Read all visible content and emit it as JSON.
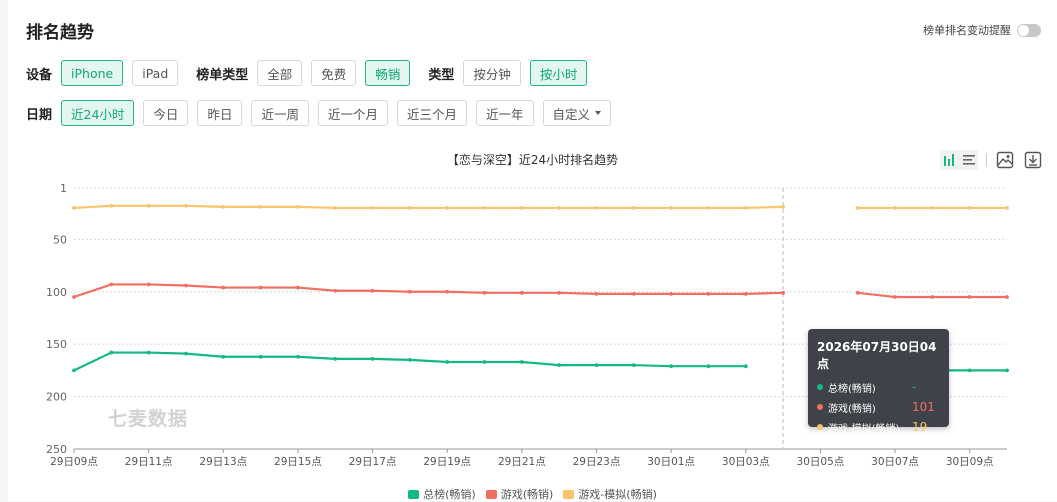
{
  "title": "排名趋势",
  "alert_toggle_label": "榜单排名变动提醒",
  "filters": {
    "device_label": "设备",
    "devices": [
      {
        "label": "iPhone",
        "active": true
      },
      {
        "label": "iPad",
        "active": false
      }
    ],
    "list_type_label": "榜单类型",
    "list_types": [
      {
        "label": "全部",
        "active": false
      },
      {
        "label": "免费",
        "active": false
      },
      {
        "label": "畅销",
        "active": true
      }
    ],
    "type_label": "类型",
    "types": [
      {
        "label": "按分钟",
        "active": false
      },
      {
        "label": "按小时",
        "active": true
      }
    ],
    "date_label": "日期",
    "dates": [
      {
        "label": "近24小时",
        "active": true
      },
      {
        "label": "今日",
        "active": false
      },
      {
        "label": "昨日",
        "active": false
      },
      {
        "label": "近一周",
        "active": false
      },
      {
        "label": "近一个月",
        "active": false
      },
      {
        "label": "近三个月",
        "active": false
      },
      {
        "label": "近一年",
        "active": false
      }
    ],
    "custom_label": "自定义"
  },
  "watermark": "七麦数据",
  "colors": {
    "accent": "#11a777",
    "series1": "#12b886",
    "series2": "#f16e63",
    "series3": "#f9c46b"
  },
  "tooltip": {
    "title": "2026年07月30日04点",
    "rows": [
      {
        "name": "总榜(畅销)",
        "value": "-",
        "color": "#12b886"
      },
      {
        "name": "游戏(畅销)",
        "value": "101",
        "color": "#f16e63"
      },
      {
        "name": "游戏-模拟(畅销)",
        "value": "19",
        "color": "#f9c46b"
      }
    ]
  },
  "chart_data": {
    "type": "line",
    "title": "【恋与深空】近24小时排名趋势",
    "x_tick_labels": [
      "29日09点",
      "29日11点",
      "29日13点",
      "29日15点",
      "29日17点",
      "29日19点",
      "29日21点",
      "29日23点",
      "30日01点",
      "30日03点",
      "30日05点",
      "30日07点",
      "30日09点"
    ],
    "y_ticks": [
      1,
      50,
      100,
      150,
      200,
      250
    ],
    "ylim": [
      1,
      250
    ],
    "y_inverted": true,
    "grid": true,
    "legend_position": "bottom",
    "hover_index": 19,
    "series": [
      {
        "name": "总榜(畅销)",
        "color": "#12b886",
        "values": [
          175,
          158,
          158,
          159,
          162,
          162,
          162,
          164,
          164,
          165,
          167,
          167,
          167,
          170,
          170,
          170,
          171,
          171,
          171,
          null,
          null,
          null,
          175,
          175,
          175,
          175
        ]
      },
      {
        "name": "游戏(畅销)",
        "color": "#f16e63",
        "values": [
          105,
          93,
          93,
          94,
          96,
          96,
          96,
          99,
          99,
          100,
          100,
          101,
          101,
          101,
          102,
          102,
          102,
          102,
          102,
          101,
          null,
          101,
          105,
          105,
          105,
          105
        ]
      },
      {
        "name": "游戏-模拟(畅销)",
        "color": "#f9c46b",
        "values": [
          20,
          18,
          18,
          18,
          19,
          19,
          19,
          20,
          20,
          20,
          20,
          20,
          20,
          20,
          20,
          20,
          20,
          20,
          20,
          19,
          null,
          20,
          20,
          20,
          20,
          20
        ]
      }
    ]
  }
}
